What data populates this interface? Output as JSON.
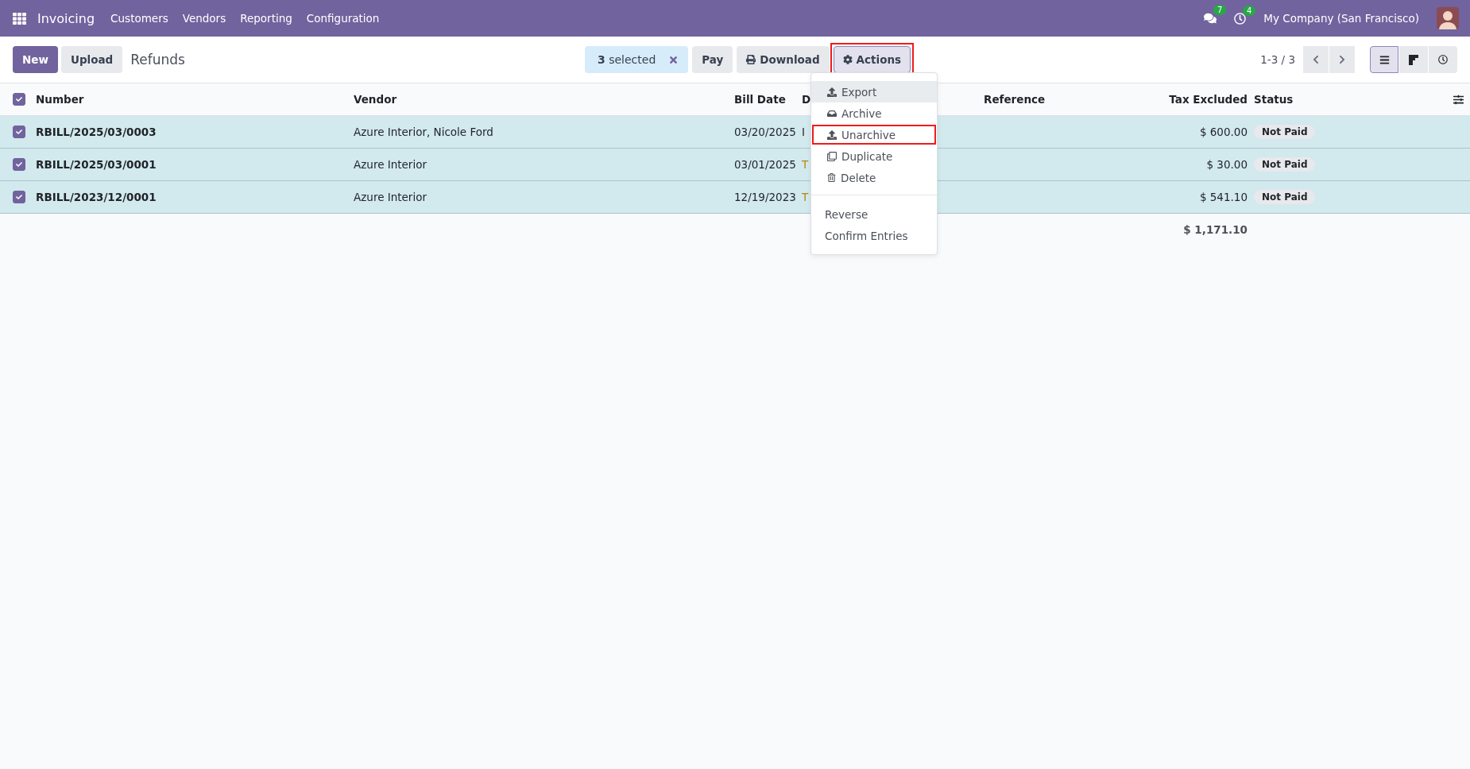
{
  "navbar": {
    "app_title": "Invoicing",
    "menu": [
      "Customers",
      "Vendors",
      "Reporting",
      "Configuration"
    ],
    "notifications": [
      {
        "kind": "chat",
        "count": "7"
      },
      {
        "kind": "activity",
        "count": "4"
      }
    ],
    "company": "My Company (San Francisco)"
  },
  "control_panel": {
    "buttons": [
      {
        "label": "New",
        "kind": "primary"
      },
      {
        "label": "Upload",
        "kind": "secondary"
      }
    ],
    "breadcrumb": "Refunds",
    "selection": {
      "count": "3",
      "label": "selected"
    },
    "actions": [
      {
        "label": "Pay",
        "kind": "plain",
        "expanded": false
      },
      {
        "label": "Download",
        "kind": "print",
        "expanded": false
      },
      {
        "label": "Actions",
        "kind": "gear",
        "highlighted": true,
        "expanded": true
      }
    ],
    "pager": "1-3 / 3",
    "views": [
      {
        "kind": "list",
        "selected": true
      },
      {
        "kind": "kanban",
        "selected": false
      },
      {
        "kind": "activity",
        "selected": false
      }
    ]
  },
  "table": {
    "all_checked": true,
    "columns": [
      "Number",
      "Vendor",
      "Bill Date",
      "D",
      "Reference",
      "Tax Excluded",
      "Status"
    ],
    "rows": [
      {
        "checked": true,
        "number": "RBILL/2025/03/0003",
        "vendor": "Azure Interior, Nicole Ford",
        "bill_date": "03/20/2025",
        "column_4": "I",
        "column_4_overdue": false,
        "tax_excluded": "$ 600.00",
        "status": "Not Paid"
      },
      {
        "checked": true,
        "number": "RBILL/2025/03/0001",
        "vendor": "Azure Interior",
        "bill_date": "03/01/2025",
        "column_4": "T",
        "column_4_overdue": true,
        "tax_excluded": "$ 30.00",
        "status": "Not Paid"
      },
      {
        "checked": true,
        "number": "RBILL/2023/12/0001",
        "vendor": "Azure Interior",
        "bill_date": "12/19/2023",
        "column_4": "T",
        "column_4_overdue": true,
        "tax_excluded": "$ 541.10",
        "status": "Not Paid"
      }
    ],
    "total": "$ 1,171.10"
  },
  "actions_menu": {
    "groups": [
      [
        {
          "label": "Export",
          "kind": "export",
          "hovered": true,
          "highlighted": false
        },
        {
          "label": "Archive",
          "kind": "archive",
          "hovered": false,
          "highlighted": false
        },
        {
          "label": "Unarchive",
          "kind": "unarchive",
          "hovered": false,
          "highlighted": true
        },
        {
          "label": "Duplicate",
          "kind": "duplicate",
          "hovered": false,
          "highlighted": false
        },
        {
          "label": "Delete",
          "kind": "delete",
          "hovered": false,
          "highlighted": false
        }
      ],
      [
        {
          "label": "Reverse",
          "kind": "text",
          "hovered": false,
          "highlighted": false
        },
        {
          "label": "Confirm Entries",
          "kind": "text",
          "hovered": false,
          "highlighted": false
        }
      ]
    ]
  }
}
